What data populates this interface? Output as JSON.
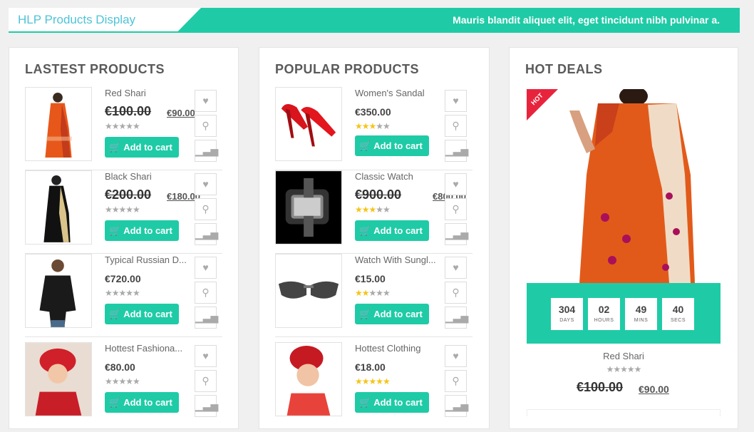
{
  "header": {
    "title": "HLP Products Display",
    "tagline": "Mauris blandit aliquet elit, eget tincidunt nibh pulvinar a."
  },
  "colors": {
    "accent": "#1fcba6",
    "title": "#4fc3d8",
    "star_on": "#f5c518"
  },
  "latest": {
    "title": "LASTEST PRODUCTS",
    "items": [
      {
        "name": "Red Shari",
        "old_price": "€100.00",
        "price": "€90.00",
        "rating": 0,
        "cart": "Add to cart"
      },
      {
        "name": "Black Shari",
        "old_price": "€200.00",
        "price": "€180.00",
        "rating": 0,
        "cart": "Add to cart"
      },
      {
        "name": "Typical Russian D...",
        "price": "€720.00",
        "rating": 0,
        "cart": "Add to cart"
      },
      {
        "name": "Hottest Fashiona...",
        "price": "€80.00",
        "rating": 0,
        "cart": "Add to cart"
      }
    ]
  },
  "popular": {
    "title": "POPULAR PRODUCTS",
    "items": [
      {
        "name": "Women's Sandal",
        "price": "€350.00",
        "rating": 3,
        "cart": "Add to cart"
      },
      {
        "name": "Classic Watch",
        "old_price": "€900.00",
        "price": "€800.00",
        "rating": 3,
        "cart": "Add to cart"
      },
      {
        "name": "Watch With Sungl...",
        "price": "€15.00",
        "rating": 2,
        "cart": "Add to cart"
      },
      {
        "name": "Hottest Clothing",
        "price": "€18.00",
        "rating": 5,
        "cart": "Add to cart"
      }
    ]
  },
  "hot": {
    "title": "HOT DEALS",
    "badge": "HOT",
    "countdown": [
      {
        "value": "304",
        "label": "DAYS"
      },
      {
        "value": "02",
        "label": "HOURS"
      },
      {
        "value": "49",
        "label": "MINS"
      },
      {
        "value": "40",
        "label": "SECS"
      }
    ],
    "name": "Red Shari",
    "old_price": "€100.00",
    "price": "€90.00",
    "rating": 0
  },
  "icons": {
    "wishlist": "heart-icon",
    "quickview": "search-icon",
    "compare": "compare-icon",
    "cart": "cart-icon"
  }
}
